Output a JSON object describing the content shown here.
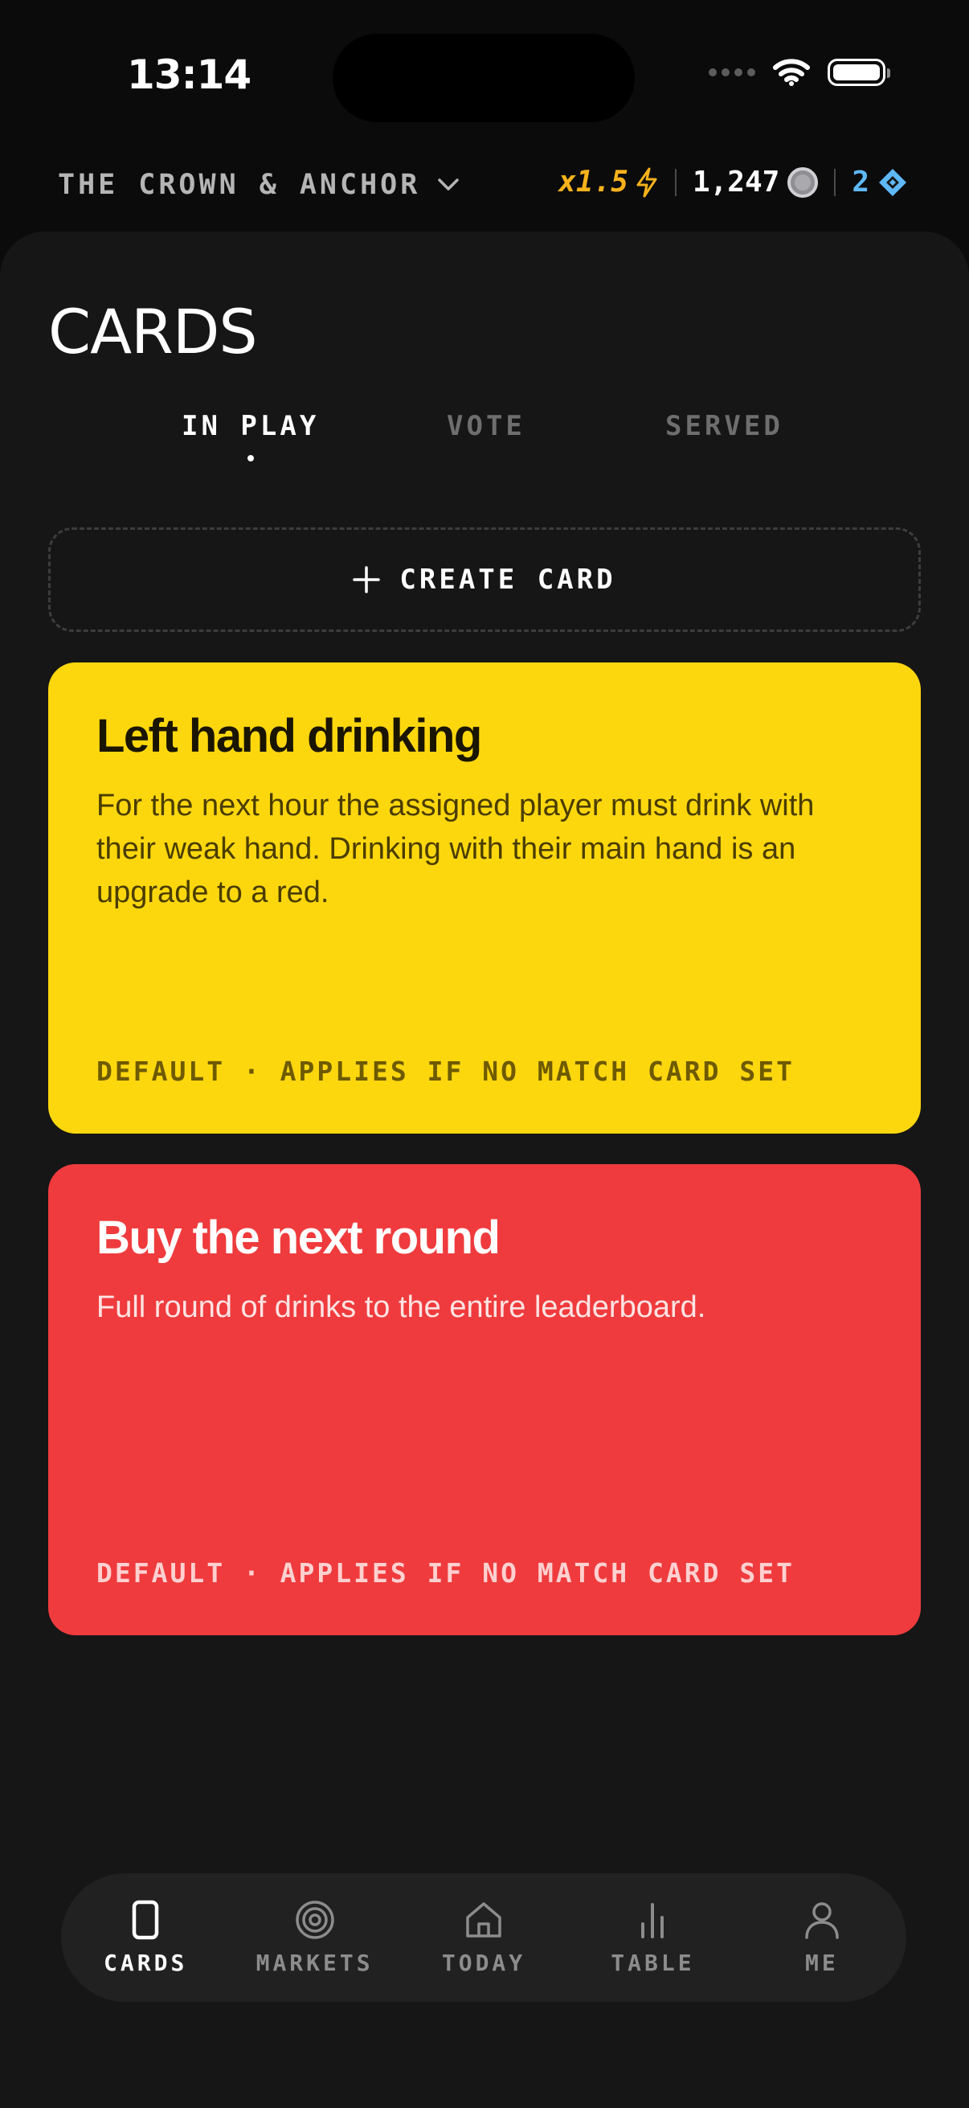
{
  "status": {
    "time": "13:14"
  },
  "header": {
    "venue": "THE CROWN & ANCHOR",
    "multiplier": "x1.5",
    "coins": "1,247",
    "gems": "2"
  },
  "page": {
    "title": "CARDS",
    "tabs": [
      {
        "label": "IN PLAY",
        "active": true
      },
      {
        "label": "VOTE",
        "active": false
      },
      {
        "label": "SERVED",
        "active": false
      }
    ],
    "create_label": "CREATE CARD"
  },
  "cards": [
    {
      "title": "Left hand drinking",
      "body": "For the next hour the assigned player must drink with their weak hand. Drinking with their main hand is an upgrade to a red.",
      "meta": "DEFAULT · APPLIES IF NO MATCH CARD SET",
      "color": "#fdd70e"
    },
    {
      "title": "Buy the next round",
      "body": "Full round of drinks to the entire leaderboard.",
      "meta": "DEFAULT · APPLIES IF NO MATCH CARD SET",
      "color": "#ef3b3d"
    }
  ],
  "nav": [
    {
      "label": "CARDS",
      "icon": "card-icon",
      "active": true
    },
    {
      "label": "MARKETS",
      "icon": "target-icon",
      "active": false
    },
    {
      "label": "TODAY",
      "icon": "home-icon",
      "active": false
    },
    {
      "label": "TABLE",
      "icon": "bar-chart-icon",
      "active": false
    },
    {
      "label": "ME",
      "icon": "person-icon",
      "active": false
    }
  ],
  "colors": {
    "background": "#0b0b0b",
    "sheet": "#161616",
    "accent_gold": "#f6b21b",
    "accent_blue": "#5fb8f6"
  }
}
